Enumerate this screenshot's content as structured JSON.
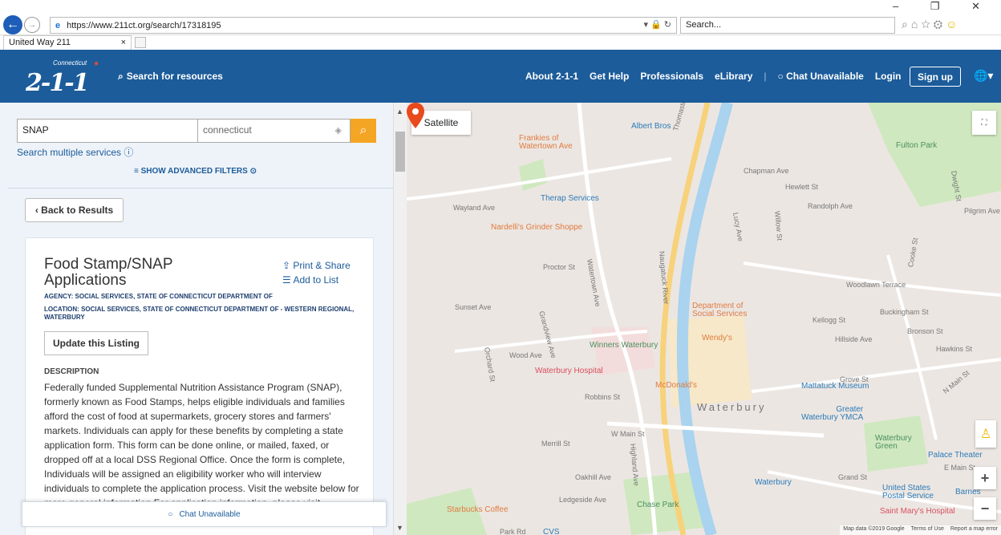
{
  "browser": {
    "url": "https://www.211ct.org/search/17318195",
    "search_placeholder": "Search...",
    "tab_title": "United Way 211",
    "window_controls": [
      "–",
      "❐",
      "✕"
    ]
  },
  "header": {
    "logo_small": "Connecticut",
    "logo_number": "2-1-1",
    "search_link": "Search for resources",
    "nav": [
      "About 2-1-1",
      "Get Help",
      "Professionals",
      "eLibrary"
    ],
    "chat": "Chat Unavailable",
    "login": "Login",
    "signup": "Sign up"
  },
  "search": {
    "query": "SNAP",
    "location": "connecticut",
    "multi": "Search multiple services",
    "advanced": "SHOW ADVANCED FILTERS"
  },
  "listing": {
    "back": "Back to Results",
    "title": "Food Stamp/SNAP Applications",
    "print_share": "Print & Share",
    "add_to_list": "Add to List",
    "agency": "AGENCY: SOCIAL SERVICES, STATE OF CONNECTICUT DEPARTMENT OF",
    "location": "LOCATION: SOCIAL SERVICES, STATE OF CONNECTICUT DEPARTMENT OF - WESTERN REGIONAL, WATERBURY",
    "update": "Update this Listing",
    "desc_head": "DESCRIPTION",
    "description": "Federally funded Supplemental Nutrition Assistance Program (SNAP), formerly known as Food Stamps, helps eligible individuals and families afford the cost of food at supermarkets, grocery stores and farmers' markets. Individuals can apply for these benefits by completing a state application form. This form can be done online, or mailed, faxed, or dropped off at a local DSS Regional Office. Once the form is complete, Individuals will be assigned an eligibility worker who will interview individuals to complete the application process. Visit the website below for more general information.For application information, please visit",
    "chat_bar": "Chat Unavailable"
  },
  "map": {
    "satellite": "Satellite",
    "attribution": [
      "Map data ©2019 Google",
      "Terms of Use",
      "Report a map error"
    ],
    "places": [
      {
        "name": "Albert Bros",
        "cls": "b"
      },
      {
        "name": "Frankies of\nWatertown Ave",
        "cls": "o"
      },
      {
        "name": "Therap Services",
        "cls": "b"
      },
      {
        "name": "Nardelli's Grinder Shoppe",
        "cls": "o"
      },
      {
        "name": "Department of\nSocial Services",
        "cls": "o"
      },
      {
        "name": "Wendy's",
        "cls": "o"
      },
      {
        "name": "Winners Waterbury",
        "cls": "g"
      },
      {
        "name": "Waterbury Hospital",
        "cls": "r"
      },
      {
        "name": "McDonald's",
        "cls": "o"
      },
      {
        "name": "Mattatuck Museum",
        "cls": "b"
      },
      {
        "name": "Greater\nWaterbury YMCA",
        "cls": "b"
      },
      {
        "name": "Waterbury",
        "cls": "mtxt"
      },
      {
        "name": "Waterbury\nGreen",
        "cls": "g"
      },
      {
        "name": "Palace Theater",
        "cls": "b"
      },
      {
        "name": "Fulton Park",
        "cls": "g"
      },
      {
        "name": "United States\nPostal Service",
        "cls": "b"
      },
      {
        "name": "Saint Mary's Hospital",
        "cls": "r"
      },
      {
        "name": "Chase Park",
        "cls": "g"
      },
      {
        "name": "Starbucks Coffee",
        "cls": "o"
      },
      {
        "name": "CVS",
        "cls": "b"
      },
      {
        "name": "Barnes",
        "cls": "b"
      },
      {
        "name": "Waterbury",
        "cls": "b"
      }
    ],
    "streets": [
      "Thomaston Ave",
      "Naugatuck River",
      "Watertown Ave",
      "Grandview Ave",
      "W Main St",
      "Highland Ave",
      "Cooke St",
      "N Main St",
      "E Main St",
      "Grand St",
      "Chapman Ave",
      "Woodlawn Terrace",
      "Buckingham St",
      "Hillside Ave",
      "Wayland Ave",
      "Wood Ave",
      "Orchard St",
      "Robbins St",
      "Merrill St",
      "Oakhill Ave",
      "Ledgeside Ave",
      "Willow St",
      "Kellogg St",
      "Bronson St",
      "Hawkins St",
      "Grove St",
      "Randolph Ave",
      "Hewlett St",
      "Lucy Ave",
      "Pilgrim Ave",
      "Dwight St",
      "Sunset Ave",
      "Proctor St",
      "Park Rd"
    ]
  }
}
